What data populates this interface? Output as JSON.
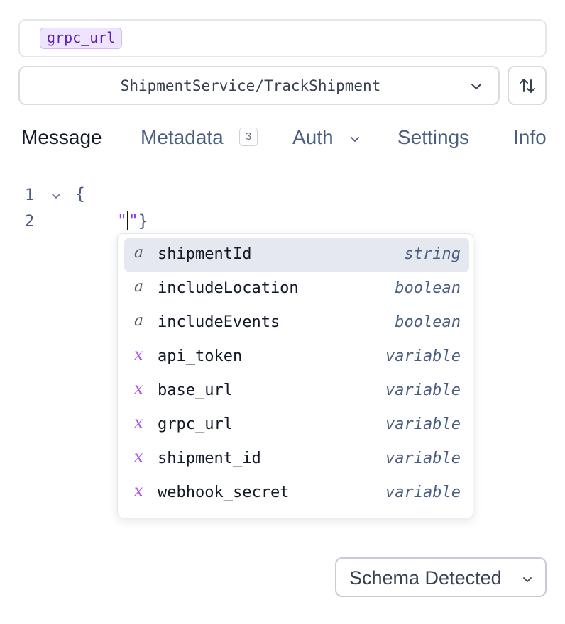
{
  "url_bar": {
    "chip_text": "grpc_url"
  },
  "method_select": {
    "value": "ShipmentService/TrackShipment"
  },
  "tabs": [
    {
      "label": "Message",
      "active": true
    },
    {
      "label": "Metadata",
      "badge": "3"
    },
    {
      "label": "Auth",
      "has_dropdown": true
    },
    {
      "label": "Settings"
    },
    {
      "label": "Info"
    }
  ],
  "editor": {
    "lines": [
      {
        "number": "1",
        "text": "{"
      },
      {
        "number": "2",
        "text": "\"\"}"
      }
    ]
  },
  "autocomplete": {
    "items": [
      {
        "kind": "a",
        "name": "shipmentId",
        "type": "string",
        "selected": true
      },
      {
        "kind": "a",
        "name": "includeLocation",
        "type": "boolean"
      },
      {
        "kind": "a",
        "name": "includeEvents",
        "type": "boolean"
      },
      {
        "kind": "x",
        "name": "api_token",
        "type": "variable"
      },
      {
        "kind": "x",
        "name": "base_url",
        "type": "variable"
      },
      {
        "kind": "x",
        "name": "grpc_url",
        "type": "variable"
      },
      {
        "kind": "x",
        "name": "shipment_id",
        "type": "variable"
      },
      {
        "kind": "x",
        "name": "webhook_secret",
        "type": "variable"
      }
    ]
  },
  "schema_button": {
    "label": "Schema Detected"
  },
  "icons": {
    "method_chevron": "chevron-down-icon",
    "swap": "swap-vertical-icon",
    "auth_chevron": "chevron-down-icon",
    "fold": "fold-chevron-icon",
    "schema_chevron": "chevron-down-icon"
  },
  "colors": {
    "chip_bg": "#efe4fd",
    "chip_text": "#5b21b6",
    "variable_kind": "#a855f7",
    "selected_row": "#e5e8ef",
    "tab_inactive": "#4b5e80"
  }
}
